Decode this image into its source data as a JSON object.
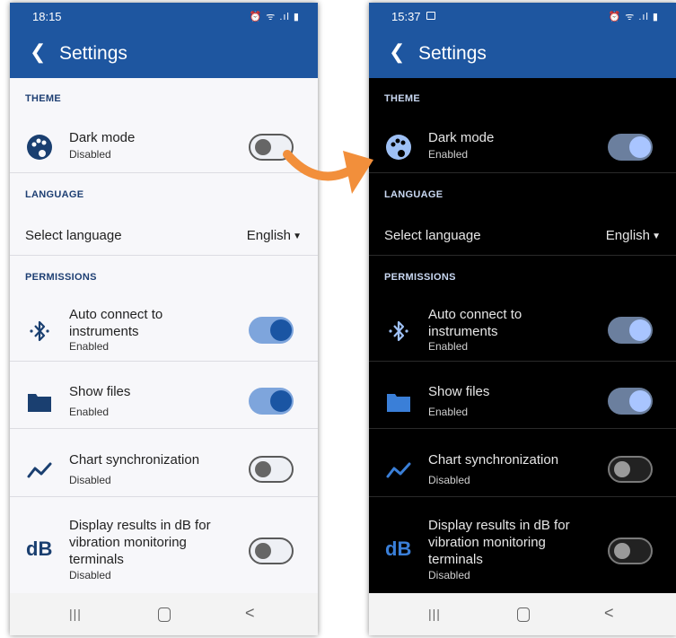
{
  "light": {
    "status_time": "18:15",
    "status_icons": "⏰ ᯤ .ıl ▮",
    "title": "Settings",
    "sections": {
      "theme": "THEME",
      "language": "LANGUAGE",
      "permissions": "PERMISSIONS"
    },
    "dark_mode": {
      "label": "Dark mode",
      "state": "Disabled",
      "enabled": false
    },
    "select_language": {
      "label": "Select language",
      "value": "English"
    },
    "auto_connect": {
      "label": "Auto connect to instruments",
      "state": "Enabled",
      "enabled": true
    },
    "show_files": {
      "label": "Show files",
      "state": "Enabled",
      "enabled": true
    },
    "chart_sync": {
      "label": "Chart synchronization",
      "state": "Disabled",
      "enabled": false
    },
    "db_display": {
      "label": "Display results in dB for vibration monitoring terminals",
      "state": "Disabled",
      "enabled": false,
      "icon_text": "dB"
    },
    "nav": {
      "recent": "|||",
      "back": "<"
    }
  },
  "dark": {
    "status_time": "15:37",
    "status_icons": "⏰ ᯤ .ıl ▮",
    "title": "Settings",
    "sections": {
      "theme": "THEME",
      "language": "LANGUAGE",
      "permissions": "PERMISSIONS"
    },
    "dark_mode": {
      "label": "Dark mode",
      "state": "Enabled",
      "enabled": true
    },
    "select_language": {
      "label": "Select language",
      "value": "English"
    },
    "auto_connect": {
      "label": "Auto connect to instruments",
      "state": "Enabled",
      "enabled": true
    },
    "show_files": {
      "label": "Show files",
      "state": "Enabled",
      "enabled": true
    },
    "chart_sync": {
      "label": "Chart synchronization",
      "state": "Disabled",
      "enabled": false
    },
    "db_display": {
      "label": "Display results in dB for vibration monitoring terminals",
      "state": "Disabled",
      "enabled": false,
      "icon_text": "dB"
    },
    "nav": {
      "recent": "|||",
      "back": "<"
    }
  },
  "colors": {
    "appbar": "#1e56a0",
    "arrow": "#f28f3b",
    "accent_light": "#1a55a3",
    "accent_dark": "#a9c5ff"
  }
}
